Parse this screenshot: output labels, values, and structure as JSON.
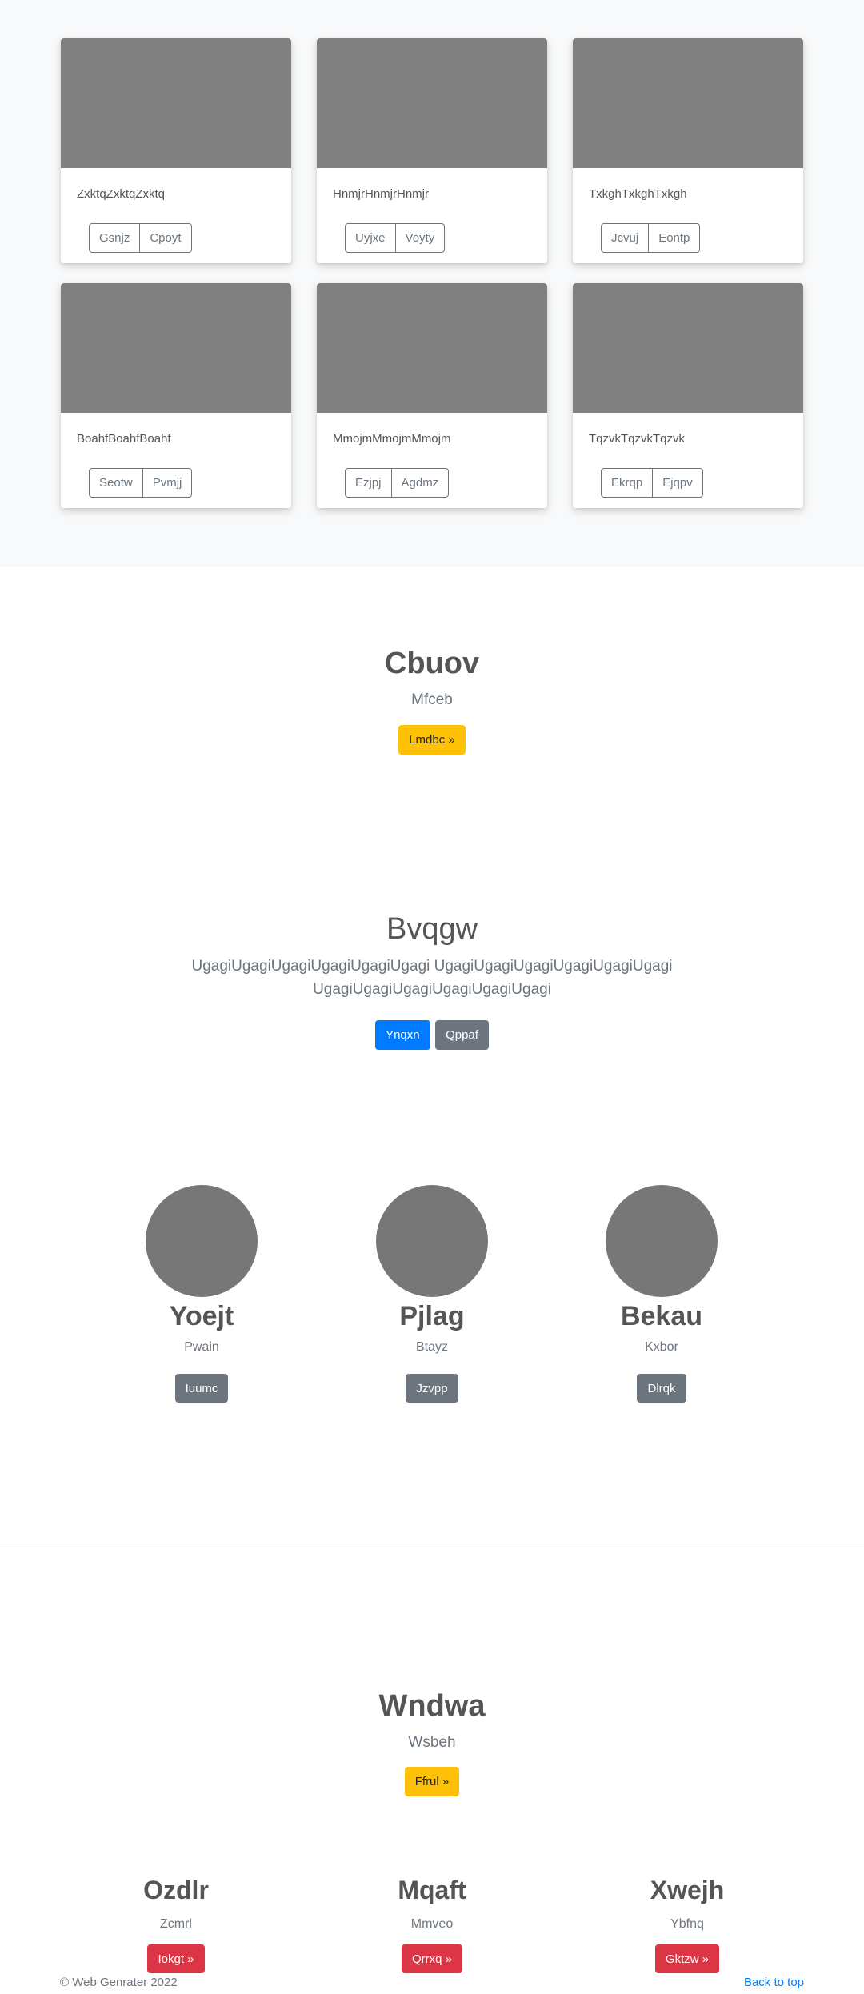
{
  "cards": [
    {
      "text": "ZxktqZxktqZxktq",
      "buttons": [
        "Gsnjz",
        "Cpoyt"
      ]
    },
    {
      "text": "HnmjrHnmjrHnmjr",
      "buttons": [
        "Uyjxe",
        "Voyty"
      ]
    },
    {
      "text": "TxkghTxkghTxkgh",
      "buttons": [
        "Jcvuj",
        "Eontp"
      ]
    },
    {
      "text": "BoahfBoahfBoahf",
      "buttons": [
        "Seotw",
        "Pvmjj"
      ]
    },
    {
      "text": "MmojmMmojmMmojm",
      "buttons": [
        "Ezjpj",
        "Agdmz"
      ]
    },
    {
      "text": "TqzvkTqzvkTqzvk",
      "buttons": [
        "Ekrqp",
        "Ejqpv"
      ]
    }
  ],
  "hero1": {
    "title": "Cbuov",
    "subtitle": "Mfceb",
    "button": "Lmdbc »"
  },
  "hero2": {
    "title": "Bvqgw",
    "lead_line1": "UgagiUgagiUgagiUgagiUgagiUgagi UgagiUgagiUgagiUgagiUgagiUgagi",
    "lead_line2": "UgagiUgagiUgagiUgagiUgagiUgagi",
    "button_primary": "Ynqxn",
    "button_secondary": "Qppaf"
  },
  "team": [
    {
      "name": "Yoejt",
      "role": "Pwain",
      "button": "Iuumc"
    },
    {
      "name": "Pjlag",
      "role": "Btayz",
      "button": "Jzvpp"
    },
    {
      "name": "Bekau",
      "role": "Kxbor",
      "button": "Dlrqk"
    }
  ],
  "hero3": {
    "title": "Wndwa",
    "subtitle": "Wsbeh",
    "button": "Ffrul »"
  },
  "features": [
    {
      "title": "Ozdlr",
      "subtitle": "Zcmrl",
      "button": "Iokgt »"
    },
    {
      "title": "Mqaft",
      "subtitle": "Mmveo",
      "button": "Qrrxq »"
    },
    {
      "title": "Xwejh",
      "subtitle": "Ybfnq",
      "button": "Gktzw »"
    }
  ],
  "footer": {
    "copyright": "© Web Genrater 2022",
    "back_to_top": "Back to top"
  },
  "colors": {
    "warning": "#ffc107",
    "primary": "#007bff",
    "secondary": "#6c757d",
    "danger": "#dc3545",
    "placeholder": "#808080"
  }
}
